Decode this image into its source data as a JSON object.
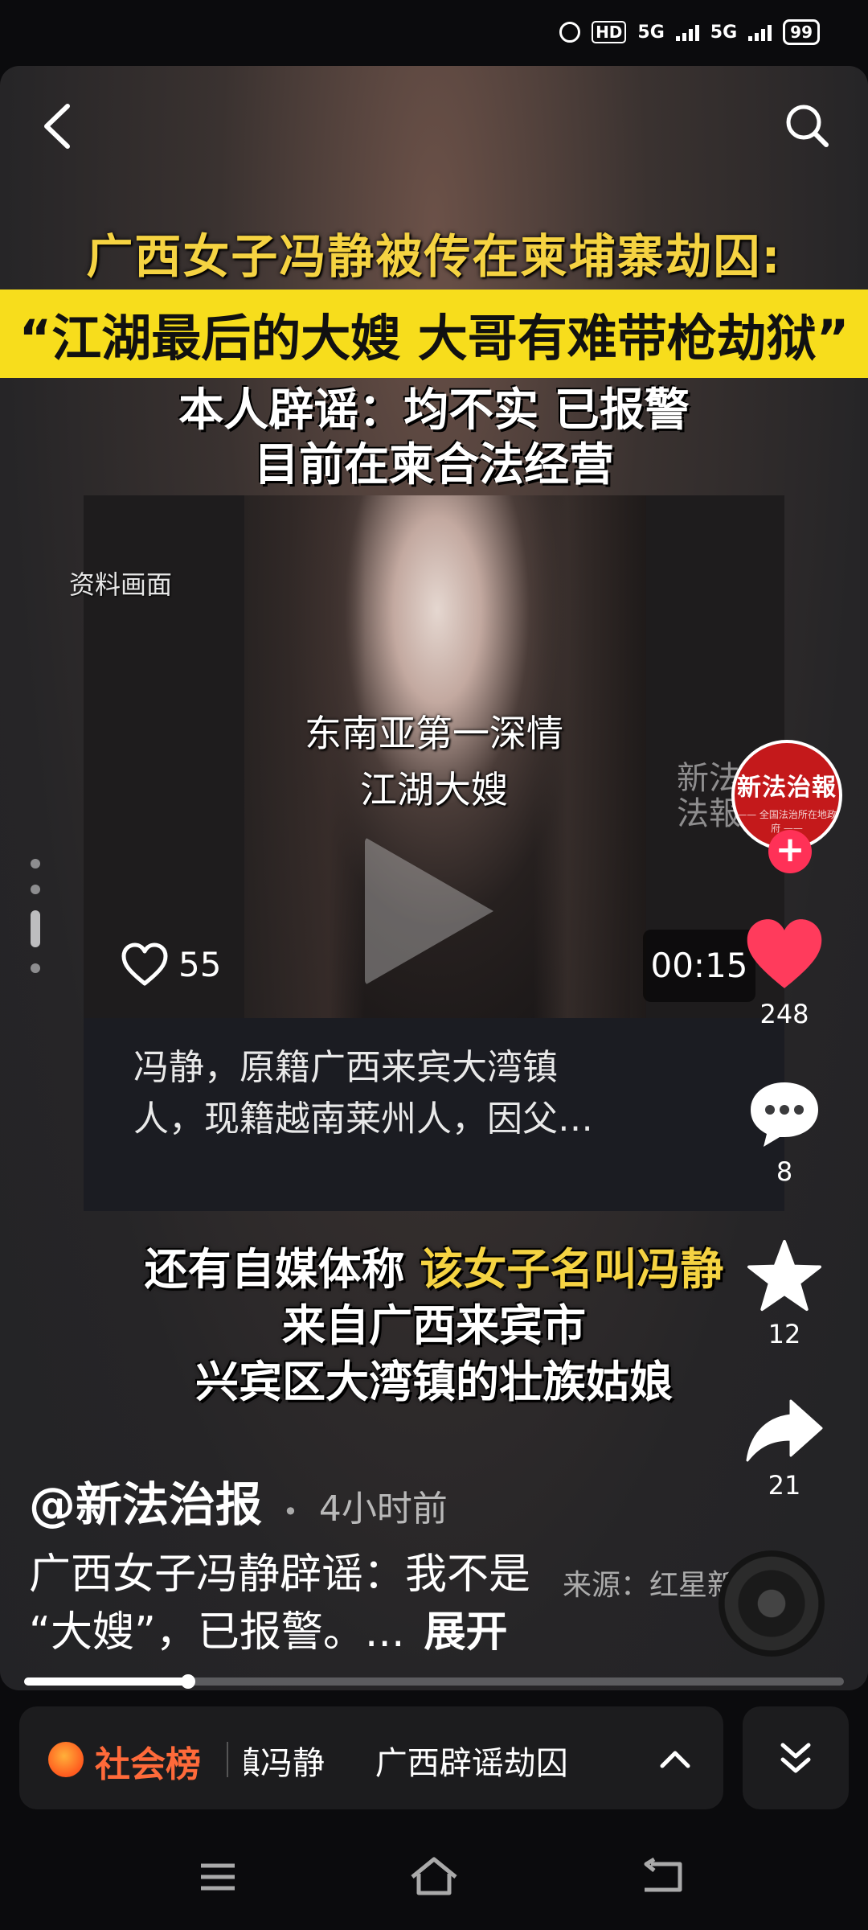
{
  "status_bar": {
    "hd": "HD",
    "net1": "5G",
    "net2": "5G",
    "battery": "99"
  },
  "video": {
    "headline_line1": "广西女子冯静被传在柬埔寨劫囚:",
    "headline_line2": "“江湖最后的大嫂 大哥有难带枪劫狱”",
    "headline_line3a": "本人辟谣：均不实 已报警",
    "headline_line3b": "目前在柬合法经营",
    "inner_card": {
      "caption_ref": "资料画面",
      "subtitle_line1": "东南亚第一深情",
      "subtitle_line2": "江湖大嫂",
      "watermark": "新法\n法報",
      "like_count": "55",
      "duration": "00:15",
      "desc_line1": "冯静，原籍广西来宾大湾镇",
      "desc_line2": "人，现籍越南莱州人，因父…"
    },
    "mid_line1_pre": "还有自媒体称 ",
    "mid_line1_hl": "该女子名叫冯静",
    "mid_line2": "来自广西来宾市",
    "mid_line3": "兴宾区大湾镇的壮族姑娘",
    "source_tag": "来源：红星新",
    "progress": 0.2
  },
  "author": {
    "name": "@新法治报",
    "time_ago": "4小时前"
  },
  "description": {
    "line1": "广西女子冯静辟谣：我不是",
    "line2": "“大嫂”，已报警。...",
    "more": "展开"
  },
  "side": {
    "avatar_brand": "新法治報",
    "avatar_sub": "—— 全国法治所在地政府 ——",
    "follow": "+",
    "likes": "248",
    "comments": "8",
    "favorites": "12",
    "shares": "21"
  },
  "hot_bar": {
    "label": "社会榜",
    "items": [
      "湾镇冯静",
      "广西辟谣劫囚"
    ]
  },
  "colors": {
    "accent_yellow": "#f5d342",
    "like_red": "#ff3b5c",
    "hot_orange": "#ff6a3a",
    "band_yellow": "#f7dd1c"
  }
}
